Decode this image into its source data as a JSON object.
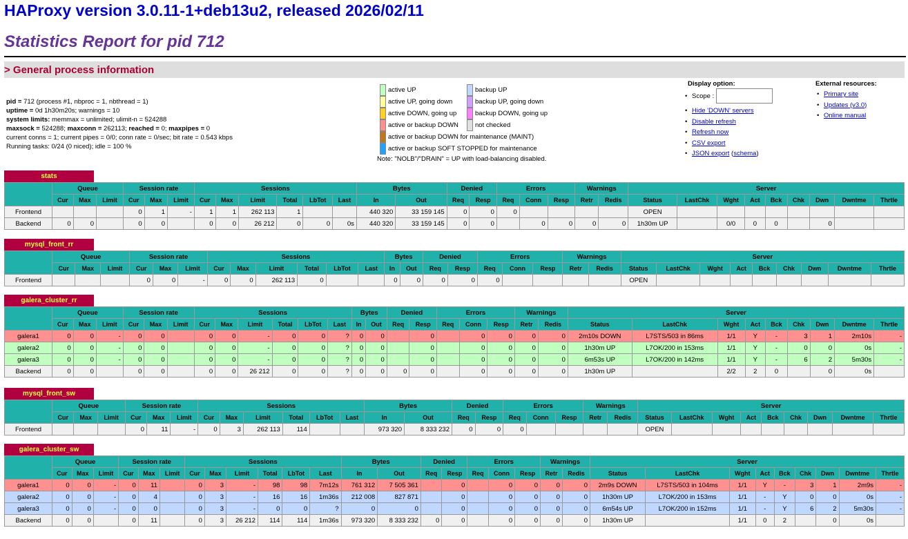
{
  "header": {
    "version": "HAProxy version 3.0.11-1+deb13u2, released 2026/02/11",
    "report": "Statistics Report for pid 712",
    "general": "> General process information"
  },
  "process": [
    {
      "k": "pid = ",
      "v": "712 (process #1, nbproc = 1, nbthread = 1)"
    },
    {
      "k": "uptime = ",
      "v": "0d 1h30m20s; warnings = 10"
    },
    {
      "k": "system limits:",
      "v": " memmax = unlimited; ulimit-n = 524288"
    },
    {
      "k": "maxsock = ",
      "v": "524288; ",
      "k2": "maxconn = ",
      "v2": "262113; ",
      "k3": "reached = ",
      "v3": "0; ",
      "k4": "maxpipes = ",
      "v4": "0"
    },
    {
      "k": "",
      "v": "current conns = 1; current pipes = 0/0; conn rate = 0/sec; bit rate = 0.543 kbps"
    },
    {
      "k": "",
      "v": "Running tasks: 0/24 (0 niced); idle = 100 %"
    }
  ],
  "legend": {
    "left": [
      {
        "label": "active UP",
        "color": "#c0ffc0"
      },
      {
        "label": "active UP, going down",
        "color": "#ffffa0"
      },
      {
        "label": "active DOWN, going up",
        "color": "#ffd020"
      },
      {
        "label": "active or backup DOWN",
        "color": "#ff9090"
      },
      {
        "label": "active or backup DOWN for maintenance (MAINT)",
        "color": "#c07820"
      },
      {
        "label": "active or backup SOFT STOPPED for maintenance",
        "color": "#20a0ff"
      }
    ],
    "right": [
      {
        "label": "backup UP",
        "color": "#c0d8ff"
      },
      {
        "label": "backup UP, going down",
        "color": "#d0a0ff"
      },
      {
        "label": "backup DOWN, going up",
        "color": "#ff80ff"
      },
      {
        "label": "not checked",
        "color": "#e0e0e0"
      }
    ],
    "note": "Note: \"NOLB\"/\"DRAIN\" = UP with load-balancing disabled."
  },
  "display": {
    "title": "Display option:",
    "scope": "Scope :",
    "links": [
      "Hide 'DOWN' servers",
      "Disable refresh",
      "Refresh now",
      "CSV export"
    ],
    "json": "JSON export",
    "schema": "schema"
  },
  "external": {
    "title": "External resources:",
    "links": [
      "Primary site",
      "Updates (v3.0)",
      "Online manual"
    ]
  },
  "groups": [
    "Queue",
    "Session rate",
    "Sessions",
    "Bytes",
    "Denied",
    "Errors",
    "Warnings",
    "Server"
  ],
  "cols": [
    "Cur",
    "Max",
    "Limit",
    "Cur",
    "Max",
    "Limit",
    "Cur",
    "Max",
    "Limit",
    "Total",
    "LbTot",
    "Last",
    "In",
    "Out",
    "Req",
    "Resp",
    "Req",
    "Conn",
    "Resp",
    "Retr",
    "Redis",
    "Status",
    "LastChk",
    "Wght",
    "Act",
    "Bck",
    "Chk",
    "Dwn",
    "Dwntme",
    "Thrtle"
  ],
  "proxies": [
    {
      "name": "stats",
      "rows": [
        {
          "cls": "frontend",
          "v": [
            "Frontend",
            "",
            "",
            "",
            "0",
            "1",
            "-",
            "1",
            "1",
            "262 113",
            "1",
            "",
            "",
            "440 320",
            "33 159 145",
            "0",
            "0",
            "0",
            "",
            "",
            "",
            "",
            "OPEN",
            "",
            "",
            "",
            "",
            "",
            "",
            "",
            ""
          ]
        },
        {
          "cls": "backend",
          "v": [
            "Backend",
            "0",
            "0",
            "",
            "0",
            "0",
            "",
            "0",
            "0",
            "26 212",
            "0",
            "0",
            "0s",
            "440 320",
            "33 159 145",
            "0",
            "0",
            "",
            "0",
            "0",
            "0",
            "0",
            "1h30m UP",
            "",
            "0/0",
            "0",
            "0",
            "",
            "0",
            "",
            ""
          ]
        }
      ]
    },
    {
      "name": "mysql_front_rr",
      "rows": [
        {
          "cls": "frontend",
          "v": [
            "Frontend",
            "",
            "",
            "",
            "0",
            "0",
            "-",
            "0",
            "0",
            "262 113",
            "0",
            "",
            "",
            "0",
            "0",
            "0",
            "0",
            "0",
            "",
            "",
            "",
            "",
            "OPEN",
            "",
            "",
            "",
            "",
            "",
            "",
            "",
            ""
          ]
        }
      ]
    },
    {
      "name": "galera_cluster_rr",
      "rows": [
        {
          "cls": "down",
          "v": [
            "galera1",
            "0",
            "0",
            "-",
            "0",
            "0",
            "",
            "0",
            "0",
            "-",
            "0",
            "0",
            "?",
            "0",
            "0",
            "",
            "0",
            "",
            "0",
            "0",
            "0",
            "0",
            "2m10s DOWN",
            "L7STS/503 in 86ms",
            "1/1",
            "Y",
            "-",
            "3",
            "1",
            "2m10s",
            "-"
          ]
        },
        {
          "cls": "up",
          "v": [
            "galera2",
            "0",
            "0",
            "-",
            "0",
            "0",
            "",
            "0",
            "0",
            "-",
            "0",
            "0",
            "?",
            "0",
            "0",
            "",
            "0",
            "",
            "0",
            "0",
            "0",
            "0",
            "1h30m UP",
            "L7OK/200 in 153ms",
            "1/1",
            "Y",
            "-",
            "0",
            "0",
            "0s",
            "-"
          ]
        },
        {
          "cls": "up",
          "v": [
            "galera3",
            "0",
            "0",
            "-",
            "0",
            "0",
            "",
            "0",
            "0",
            "-",
            "0",
            "0",
            "?",
            "0",
            "0",
            "",
            "0",
            "",
            "0",
            "0",
            "0",
            "0",
            "6m53s UP",
            "L7OK/200 in 142ms",
            "1/1",
            "Y",
            "-",
            "6",
            "2",
            "5m30s",
            "-"
          ]
        },
        {
          "cls": "backend",
          "v": [
            "Backend",
            "0",
            "0",
            "",
            "0",
            "0",
            "",
            "0",
            "0",
            "26 212",
            "0",
            "0",
            "?",
            "0",
            "0",
            "0",
            "0",
            "",
            "0",
            "0",
            "0",
            "0",
            "1h30m UP",
            "",
            "2/2",
            "2",
            "0",
            "",
            "0",
            "0s",
            ""
          ]
        }
      ]
    },
    {
      "name": "mysql_front_sw",
      "rows": [
        {
          "cls": "frontend",
          "v": [
            "Frontend",
            "",
            "",
            "",
            "0",
            "11",
            "-",
            "0",
            "3",
            "262 113",
            "114",
            "",
            "",
            "973 320",
            "8 333 232",
            "0",
            "0",
            "0",
            "",
            "",
            "",
            "",
            "OPEN",
            "",
            "",
            "",
            "",
            "",
            "",
            "",
            ""
          ]
        }
      ]
    },
    {
      "name": "galera_cluster_sw",
      "rows": [
        {
          "cls": "down",
          "v": [
            "galera1",
            "0",
            "0",
            "-",
            "0",
            "11",
            "",
            "0",
            "3",
            "-",
            "98",
            "98",
            "7m12s",
            "761 312",
            "7 505 361",
            "",
            "0",
            "",
            "0",
            "0",
            "0",
            "0",
            "2m9s DOWN",
            "L7STS/503 in 104ms",
            "1/1",
            "Y",
            "-",
            "3",
            "1",
            "2m9s",
            "-"
          ]
        },
        {
          "cls": "bkup",
          "v": [
            "galera2",
            "0",
            "0",
            "-",
            "0",
            "4",
            "",
            "0",
            "3",
            "-",
            "16",
            "16",
            "1m36s",
            "212 008",
            "827 871",
            "",
            "0",
            "",
            "0",
            "0",
            "0",
            "0",
            "1h30m UP",
            "L7OK/200 in 153ms",
            "1/1",
            "-",
            "Y",
            "0",
            "0",
            "0s",
            "-"
          ]
        },
        {
          "cls": "bkup",
          "v": [
            "galera3",
            "0",
            "0",
            "-",
            "0",
            "0",
            "",
            "0",
            "3",
            "-",
            "0",
            "0",
            "?",
            "0",
            "0",
            "",
            "0",
            "",
            "0",
            "0",
            "0",
            "0",
            "6m54s UP",
            "L7OK/200 in 152ms",
            "1/1",
            "-",
            "Y",
            "6",
            "2",
            "5m30s",
            "-"
          ]
        },
        {
          "cls": "backend",
          "v": [
            "Backend",
            "0",
            "0",
            "",
            "0",
            "11",
            "",
            "0",
            "3",
            "26 212",
            "114",
            "114",
            "1m36s",
            "973 320",
            "8 333 232",
            "0",
            "0",
            "",
            "0",
            "0",
            "0",
            "0",
            "1h30m UP",
            "",
            "1/1",
            "0",
            "2",
            "",
            "0",
            "0s",
            ""
          ]
        }
      ]
    }
  ]
}
